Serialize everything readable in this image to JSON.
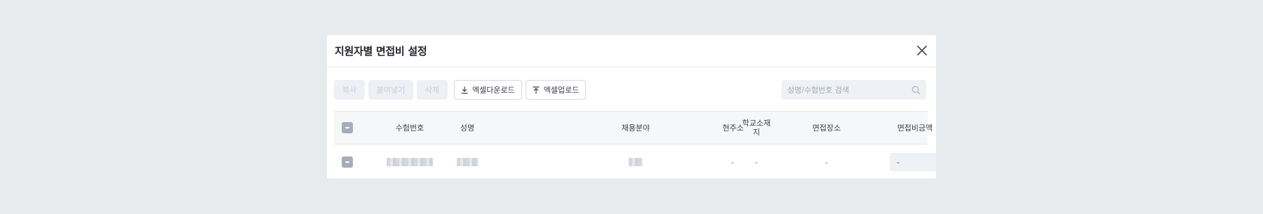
{
  "modal": {
    "title": "지원자별 면접비 설정",
    "close_icon": "close-icon"
  },
  "toolbar": {
    "copy_label": "복사",
    "paste_label": "붙여넣기",
    "delete_label": "삭제",
    "excel_download_label": "엑셀다운로드",
    "excel_download_icon": "download-icon",
    "excel_upload_label": "엑셀업로드",
    "excel_upload_icon": "upload-icon"
  },
  "search": {
    "placeholder": "성명/수험번호 검색",
    "icon": "search-icon"
  },
  "table": {
    "headers": {
      "exam_number": "수험번호",
      "name": "성명",
      "field": "채용분야",
      "address": "현주소",
      "school_location": "학교소재지",
      "interview_location": "면접장소",
      "interview_fee": "면접비금액"
    },
    "rows": [
      {
        "address": "-",
        "school_location": "-",
        "interview_location": "-",
        "interview_fee": "-"
      }
    ]
  },
  "colors": {
    "background": "#e8ebee",
    "checkbox": "#a6adb8",
    "disabled_button": "#edf0f4",
    "input_background": "#eef1f5"
  }
}
